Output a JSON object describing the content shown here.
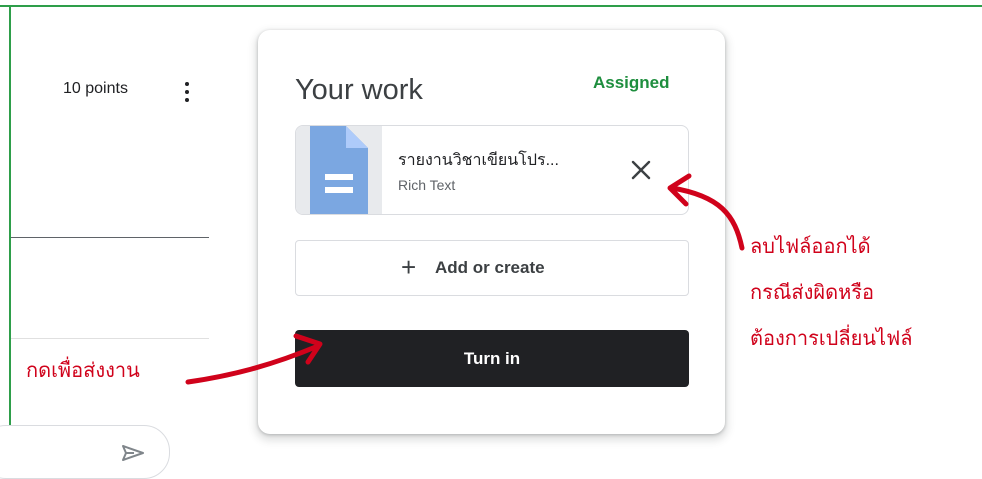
{
  "header": {
    "points_label": "10 points",
    "menu_icon": "more-vert-icon"
  },
  "card": {
    "title": "Your work",
    "status": "Assigned",
    "attachment": {
      "name": "รายงานวิชาเขียนโปร...",
      "type": "Rich Text",
      "icon": "document-icon",
      "remove_icon": "close-icon"
    },
    "add_or_create_label": "Add or create",
    "turn_in_label": "Turn in"
  },
  "annotations": {
    "remove_note_lines": [
      "ลบไฟล์ออกได้",
      "กรณีส่งผิดหรือ",
      "ต้องการเปลี่ยนไฟล์"
    ],
    "turn_in_note": "กดเพื่อส่งงาน",
    "color": "#d0021b"
  },
  "colors": {
    "status_green": "#1e8e3e",
    "button_dark": "#202124",
    "doc_blue": "#7ba7e1",
    "frame_green": "#2e9e4a"
  }
}
